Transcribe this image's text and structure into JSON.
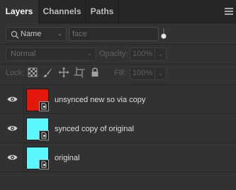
{
  "tabs": [
    {
      "label": "Layers",
      "active": true
    },
    {
      "label": "Channels",
      "active": false
    },
    {
      "label": "Paths",
      "active": false
    }
  ],
  "filter": {
    "kind_label": "Name",
    "kind_icon": "search-icon",
    "search_value": "face"
  },
  "blend": {
    "mode": "Normal",
    "opacity_label": "Opacity:",
    "opacity_value": "100%"
  },
  "lock": {
    "label": "Lock:",
    "icons": [
      "lock-transparent-pixels-icon",
      "lock-image-pixels-icon",
      "lock-position-icon",
      "lock-artboard-icon",
      "lock-all-icon"
    ],
    "fill_label": "Fill:",
    "fill_value": "100%"
  },
  "layers": [
    {
      "name": "unsynced new so via copy",
      "visible": true,
      "thumb_color": "#e4170b",
      "smart_object": true
    },
    {
      "name": "synced copy of original",
      "visible": true,
      "thumb_color": "#5cf8ff",
      "smart_object": true
    },
    {
      "name": "original",
      "visible": true,
      "thumb_color": "#5cf8ff",
      "smart_object": true
    }
  ],
  "colors": {
    "panel_bg": "#323232",
    "tabbar_bg": "#262626"
  }
}
